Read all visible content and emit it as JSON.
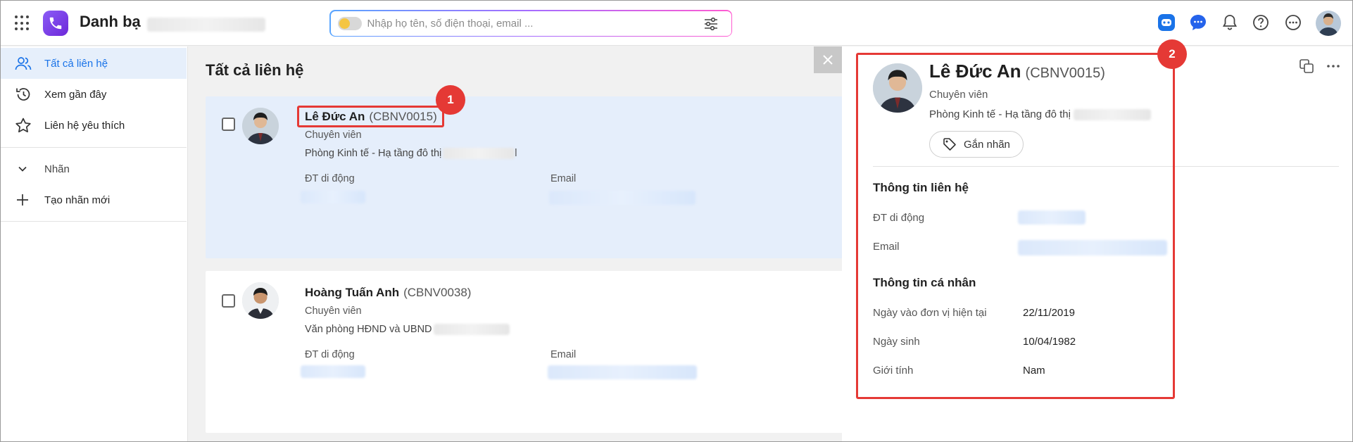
{
  "app": {
    "title": "Danh bạ",
    "search_placeholder": "Nhập họ tên, số điện thoại, email ..."
  },
  "topbar_icons": [
    "ai-assistant-icon",
    "chat-icon",
    "bell-icon",
    "help-icon",
    "more-icon",
    "user-avatar"
  ],
  "sidebar": {
    "items": [
      {
        "label": "Tất cả liên hệ",
        "icon": "contacts-icon",
        "active": true
      },
      {
        "label": "Xem gần đây",
        "icon": "history-icon",
        "active": false
      },
      {
        "label": "Liên hệ yêu thích",
        "icon": "star-icon",
        "active": false
      }
    ],
    "labels_header": "Nhãn",
    "create_label": "Tạo nhãn mới"
  },
  "main": {
    "title": "Tất cả liên hệ",
    "contacts": [
      {
        "name": "Lê Đức An",
        "code": "(CBNV0015)",
        "role": "Chuyên viên",
        "dept": "Phòng Kinh tế - Hạ tầng đô thị",
        "dept_suffix": "l",
        "mobile_label": "ĐT di động",
        "email_label": "Email",
        "selected": true
      },
      {
        "name": "Hoàng Tuấn Anh",
        "code": "(CBNV0038)",
        "role": "Chuyên viên",
        "dept": "Văn phòng HĐND và UBND",
        "mobile_label": "ĐT di động",
        "email_label": "Email",
        "selected": false
      }
    ]
  },
  "detail": {
    "name": "Lê Đức An",
    "code": "(CBNV0015)",
    "role": "Chuyên viên",
    "dept": "Phòng Kinh tế - Hạ tầng đô thị",
    "tag_button": "Gắn nhãn",
    "contact_section": "Thông tin liên hệ",
    "mobile_label": "ĐT di động",
    "email_label": "Email",
    "personal_section": "Thông tin cá nhân",
    "join_date_label": "Ngày vào đơn vị hiện tại",
    "join_date": "22/11/2019",
    "birth_label": "Ngày sinh",
    "birth_date": "10/04/1982",
    "gender_label": "Giới tính",
    "gender": "Nam"
  },
  "annotations": {
    "badge1": "1",
    "badge2": "2",
    "color": "#e53935"
  }
}
